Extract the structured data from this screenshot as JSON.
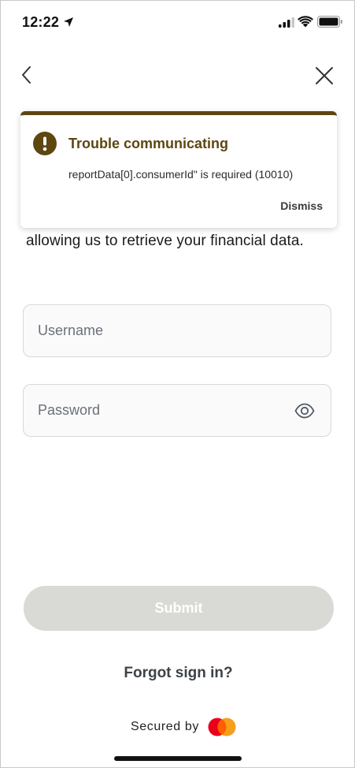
{
  "status_bar": {
    "time": "12:22",
    "icons": [
      "location-arrow-icon",
      "cellular-signal-icon",
      "wifi-icon",
      "battery-icon"
    ]
  },
  "nav": {
    "back_icon": "chevron-left-icon",
    "close_icon": "close-icon"
  },
  "banner": {
    "icon": "exclamation-circle-icon",
    "title": "Trouble communicating",
    "message": "reportData[0].consumerId\" is required (10010)",
    "dismiss_label": "Dismiss",
    "accent_color": "#5e4611"
  },
  "subtext": "allowing us to retrieve your financial data.",
  "form": {
    "username": {
      "placeholder": "Username",
      "value": ""
    },
    "password": {
      "placeholder": "Password",
      "value": "",
      "toggle_icon": "eye-icon"
    },
    "submit_label": "Submit",
    "submit_color": "#d9d9d6"
  },
  "forgot_label": "Forgot sign in?",
  "footer": {
    "secured_label": "Secured by",
    "logo": "mastercard-logo"
  }
}
